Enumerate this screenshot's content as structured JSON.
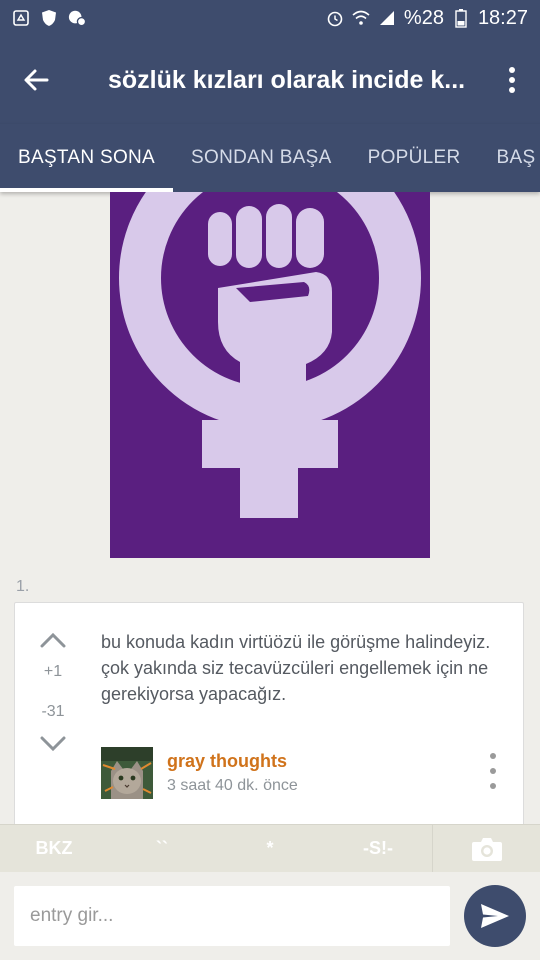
{
  "status_bar": {
    "battery": "%28",
    "time": "18:27",
    "icons": [
      "recycle-icon",
      "shield-icon",
      "chat-notification-icon",
      "alarm-icon",
      "wifi-icon",
      "signal-icon",
      "battery-icon"
    ]
  },
  "app_bar": {
    "title": "sözlük kızları olarak incide k...",
    "back_icon": "arrow-left-icon",
    "menu_icon": "more-vertical-icon"
  },
  "tabs": [
    {
      "label": "BAŞTAN SONA",
      "active": true
    },
    {
      "label": "SONDAN BAŞA",
      "active": false
    },
    {
      "label": "POPÜLER",
      "active": false
    },
    {
      "label": "BAŞ",
      "active": false
    }
  ],
  "image": {
    "icon": "feminism-fist-symbol",
    "background": "#5a1f80",
    "foreground": "#d8c9ea"
  },
  "entry": {
    "index": "1.",
    "plus": "+1",
    "minus": "-31",
    "text": "bu konuda kadın virtüözü ile görüşme halindeyiz. çok yakında siz tecavüzcüleri engellemek için ne gerekiyorsa yapacağız.",
    "author": "gray thoughts",
    "time": "3 saat 40 dk. önce"
  },
  "toolbar": {
    "bkz": "BKZ",
    "grave": "``",
    "star": "*",
    "spoiler": "-S!-",
    "camera_icon": "camera-icon"
  },
  "input": {
    "placeholder": "entry gir..."
  },
  "colors": {
    "primary": "#3e4c6d",
    "author": "#d0731b",
    "background": "#efeeea"
  }
}
